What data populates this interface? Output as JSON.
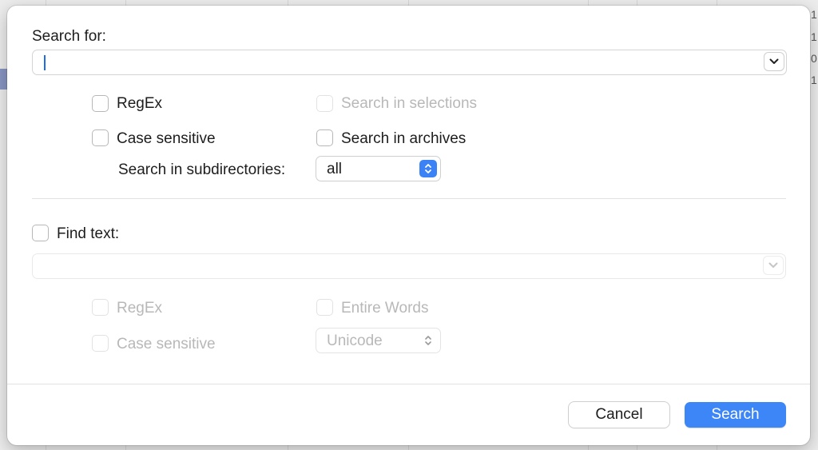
{
  "background": {
    "edge_digits": [
      "1",
      "1",
      "0",
      "1"
    ]
  },
  "dialog": {
    "search_label": "Search for:",
    "search_value": "",
    "options": {
      "regex": "RegEx",
      "case_sensitive": "Case sensitive",
      "search_in_selections": "Search in selections",
      "search_in_archives": "Search in archives",
      "subdirectories_label": "Search in subdirectories:",
      "subdirectories_value": "all"
    },
    "find_text": {
      "label": "Find text:",
      "value": "",
      "regex": "RegEx",
      "case_sensitive": "Case sensitive",
      "entire_words": "Entire Words",
      "encoding_value": "Unicode"
    },
    "buttons": {
      "cancel": "Cancel",
      "search": "Search"
    }
  },
  "colors": {
    "accent": "#3d86f7",
    "caret": "#1a6fe8",
    "disabled_text": "#b8b8b8"
  },
  "icons": {
    "combo_dropdown": "chevron-down-icon",
    "popup_stepper": "up-down-chevrons-icon"
  }
}
